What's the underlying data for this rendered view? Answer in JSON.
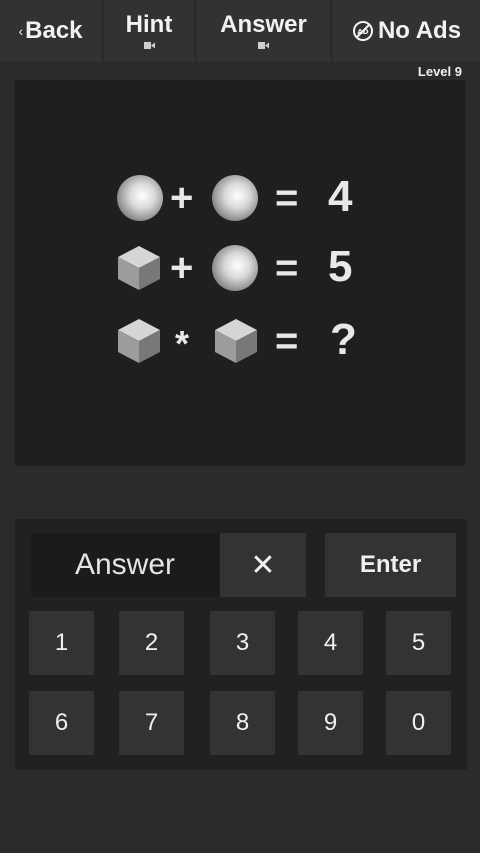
{
  "header": {
    "back_label": "Back",
    "hint_label": "Hint",
    "answer_label": "Answer",
    "noads_label": "No Ads",
    "level_label": "Level 9"
  },
  "puzzle": {
    "rows": [
      {
        "left": "sphere",
        "op": "+",
        "right": "sphere",
        "eq": "=",
        "result": "4"
      },
      {
        "left": "cube",
        "op": "+",
        "right": "sphere",
        "eq": "=",
        "result": "5"
      },
      {
        "left": "cube",
        "op": "*",
        "right": "cube",
        "eq": "=",
        "result": "?"
      }
    ]
  },
  "keypad": {
    "answer_placeholder": "Answer",
    "clear_label": "✕",
    "enter_label": "Enter",
    "digits": [
      "1",
      "2",
      "3",
      "4",
      "5",
      "6",
      "7",
      "8",
      "9",
      "0"
    ]
  }
}
